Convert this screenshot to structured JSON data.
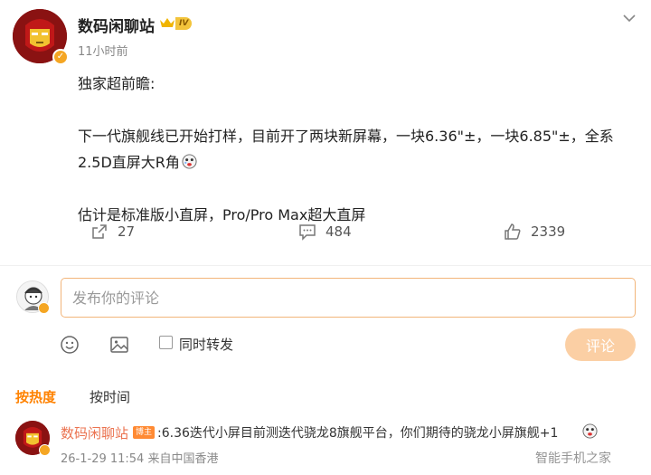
{
  "post": {
    "author_name": "数码闲聊站",
    "level_badge": "IV",
    "time": "11小时前",
    "paragraphs": [
      "独家超前瞻:",
      "下一代旗舰线已开始打样，目前开了两块新屏幕，一块6.36\"±，一块6.85\"±，全系2.5D直屏大R角",
      "估计是标准版小直屏，Pro/Pro Max超大直屏"
    ]
  },
  "actions": {
    "share_count": "27",
    "comment_count": "484",
    "like_count": "2339"
  },
  "composer": {
    "placeholder": "发布你的评论",
    "repost_label": "同时转发",
    "submit_label": "评论"
  },
  "sort": {
    "hot_label": "按热度",
    "time_label": "按时间"
  },
  "comment": {
    "name": "数码闲聊站",
    "author_tag": "博主",
    "text": ":6.36迭代小屏目前测迭代骁龙8旗舰平台，你们期待的骁龙小屏旗舰+1",
    "meta": "26-1-29 11:54 来自中国香港"
  },
  "watermark": "智能手机之家",
  "colors": {
    "accent_orange": "#ff8200",
    "name_orange": "#eb7350",
    "submit_disabled": "#fbcfa4",
    "input_border": "#f2b57a",
    "verified_gold": "#f5a623"
  },
  "icons": [
    "crown-icon",
    "chevron-down-icon",
    "share-icon",
    "comment-icon",
    "like-icon",
    "emoji-icon",
    "image-icon",
    "checkbox-icon",
    "verified-icon"
  ]
}
